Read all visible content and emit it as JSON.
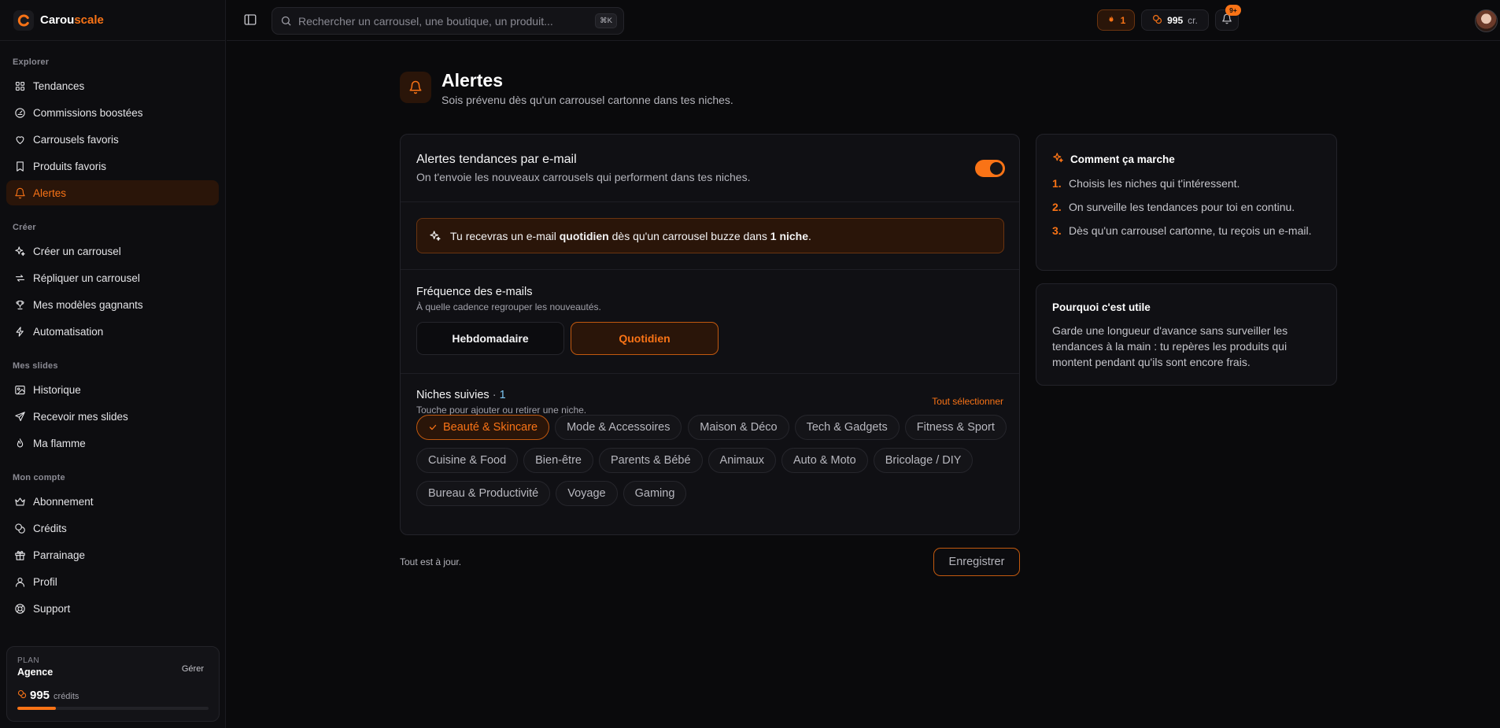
{
  "brand": {
    "name_a": "Carou",
    "name_b": "scale",
    "accent": "#f97316"
  },
  "sidebar": {
    "sections": [
      {
        "heading": "Explorer",
        "items": [
          {
            "label": "Tendances",
            "icon": "grid-icon"
          },
          {
            "label": "Commissions boostées",
            "icon": "gauge-icon"
          },
          {
            "label": "Carrousels favoris",
            "icon": "heart-icon"
          },
          {
            "label": "Produits favoris",
            "icon": "bookmark-icon"
          },
          {
            "label": "Alertes",
            "icon": "bell-icon",
            "active": true
          }
        ]
      },
      {
        "heading": "Créer",
        "items": [
          {
            "label": "Créer un carrousel",
            "icon": "sparkles-icon"
          },
          {
            "label": "Répliquer un carrousel",
            "icon": "repeat-icon"
          },
          {
            "label": "Mes modèles gagnants",
            "icon": "trophy-icon"
          },
          {
            "label": "Automatisation",
            "icon": "zap-icon"
          }
        ]
      },
      {
        "heading": "Mes slides",
        "items": [
          {
            "label": "Historique",
            "icon": "image-icon"
          },
          {
            "label": "Recevoir mes slides",
            "icon": "send-icon"
          },
          {
            "label": "Ma flamme",
            "icon": "flame-icon"
          }
        ]
      },
      {
        "heading": "Mon compte",
        "items": [
          {
            "label": "Abonnement",
            "icon": "crown-icon"
          },
          {
            "label": "Crédits",
            "icon": "coins-icon"
          },
          {
            "label": "Parrainage",
            "icon": "gift-icon"
          },
          {
            "label": "Profil",
            "icon": "user-icon"
          },
          {
            "label": "Support",
            "icon": "lifebuoy-icon"
          }
        ]
      }
    ],
    "plan": {
      "label": "PLAN",
      "name": "Agence",
      "manage": "Gérer",
      "credits": "995",
      "credits_unit": "crédits",
      "credits_fill": 0.2
    }
  },
  "topbar": {
    "search_placeholder": "Rechercher un carrousel, une boutique, un produit...",
    "shortcut": "⌘K",
    "streak": "1",
    "credits": "995",
    "credits_unit": "cr.",
    "notif_badge": "9+"
  },
  "page": {
    "title": "Alertes",
    "subtitle": "Sois prévenu dès qu'un carrousel cartonne dans tes niches."
  },
  "email_alerts": {
    "title": "Alertes tendances par e-mail",
    "subtitle": "On t'envoie les nouveaux carrousels qui performent dans tes niches.",
    "enabled": true,
    "info_pre": "Tu recevras un e-mail",
    "info_freq": "quotidien",
    "info_mid": "dès qu'un carrousel buzze dans",
    "info_count": "1 niche",
    "info_end": "."
  },
  "frequency": {
    "title": "Fréquence des e-mails",
    "subtitle": "À quelle cadence regrouper les nouveautés.",
    "options": [
      "Hebdomadaire",
      "Quotidien"
    ],
    "selected": "Quotidien"
  },
  "niches": {
    "title": "Niches suivies",
    "sep": " · ",
    "count": "1",
    "subtitle": "Touche pour ajouter ou retirer une niche.",
    "select_all": "Tout sélectionner",
    "items": [
      "Beauté & Skincare",
      "Mode & Accessoires",
      "Maison & Déco",
      "Tech & Gadgets",
      "Fitness & Sport",
      "Cuisine & Food",
      "Bien-être",
      "Parents & Bébé",
      "Animaux",
      "Auto & Moto",
      "Bricolage / DIY",
      "Bureau & Productivité",
      "Voyage",
      "Gaming"
    ],
    "selected": [
      "Beauté & Skincare"
    ]
  },
  "footer": {
    "status": "Tout est à jour.",
    "save": "Enregistrer"
  },
  "how_it_works": {
    "title": "Comment ça marche",
    "steps": [
      {
        "n": "1.",
        "text": "Choisis les niches qui t'intéressent."
      },
      {
        "n": "2.",
        "text": "On surveille les tendances pour toi en continu."
      },
      {
        "n": "3.",
        "text": "Dès qu'un carrousel cartonne, tu reçois un e-mail."
      }
    ]
  },
  "why_useful": {
    "title": "Pourquoi c'est utile",
    "text": "Garde une longueur d'avance sans surveiller les tendances à la main : tu repères les produits qui montent pendant qu'ils sont encore frais."
  }
}
